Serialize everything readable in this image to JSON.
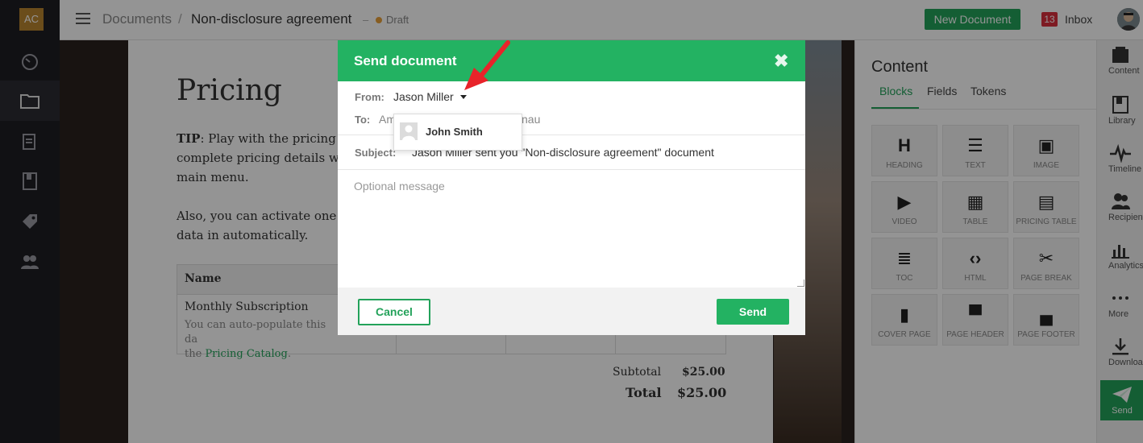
{
  "app": {
    "avatar_initials": "AC"
  },
  "header": {
    "breadcrumb_root": "Documents",
    "breadcrumb_sep": "/",
    "doc_title": "Non-disclosure agreement",
    "dash": "–",
    "status": "Draft",
    "new_doc_label": "New Document",
    "inbox_count": "13",
    "inbox_label": "Inbox"
  },
  "left_nav": {
    "icons": [
      "dashboard-icon",
      "folder-icon",
      "documents-icon",
      "library-icon",
      "tag-icon",
      "users-icon"
    ]
  },
  "document": {
    "heading": "Pricing",
    "tip_label": "TIP",
    "tip_line1": ": Play with the pricing t",
    "tip_line2": "complete pricing details wi",
    "tip_line3": "main menu.",
    "also_line1": "Also, you can activate one o",
    "also_line2": "data in automatically.",
    "table": {
      "header_name": "Name",
      "row_name": "Monthly Subscription",
      "row_desc": "You can auto-populate this da",
      "row_desc2_prefix": "the ",
      "row_link": "Pricing Catalog",
      "row_desc2_suffix": "."
    },
    "subtotal_label": "Subtotal",
    "subtotal_value": "$25.00",
    "total_label": "Total",
    "total_value": "$25.00"
  },
  "content_panel": {
    "title": "Content",
    "tabs": [
      "Blocks",
      "Fields",
      "Tokens"
    ],
    "blocks": [
      {
        "label": "HEADING",
        "icon": "H"
      },
      {
        "label": "TEXT",
        "icon": "☰"
      },
      {
        "label": "IMAGE",
        "icon": "▣"
      },
      {
        "label": "VIDEO",
        "icon": "▶"
      },
      {
        "label": "TABLE",
        "icon": "▦"
      },
      {
        "label": "PRICING TABLE",
        "icon": "▤"
      },
      {
        "label": "TOC",
        "icon": "≣"
      },
      {
        "label": "HTML",
        "icon": "‹›"
      },
      {
        "label": "PAGE BREAK",
        "icon": "✂"
      },
      {
        "label": "COVER PAGE",
        "icon": "▮"
      },
      {
        "label": "PAGE HEADER",
        "icon": "▀"
      },
      {
        "label": "PAGE FOOTER",
        "icon": "▄"
      }
    ]
  },
  "tool_rail": {
    "items": [
      "Content",
      "Library",
      "Timeline",
      "Recipients",
      "Analytics",
      "More",
      "Download",
      "Send"
    ]
  },
  "modal": {
    "title": "Send document",
    "close": "✖",
    "from_label": "From:",
    "from_value": "Jason Miller",
    "to_label": "To:",
    "to_value": "Am",
    "to_value_tail": "nau",
    "subject_label": "Subject:",
    "subject_value": "Jason Miller sent you \"Non-disclosure agreement\" document",
    "message_placeholder": "Optional message",
    "cancel_label": "Cancel",
    "send_label": "Send",
    "dropdown_option": "John Smith"
  },
  "colors": {
    "accent": "#23b262",
    "arrow": "#e8232a",
    "badge": "#d9303d"
  }
}
